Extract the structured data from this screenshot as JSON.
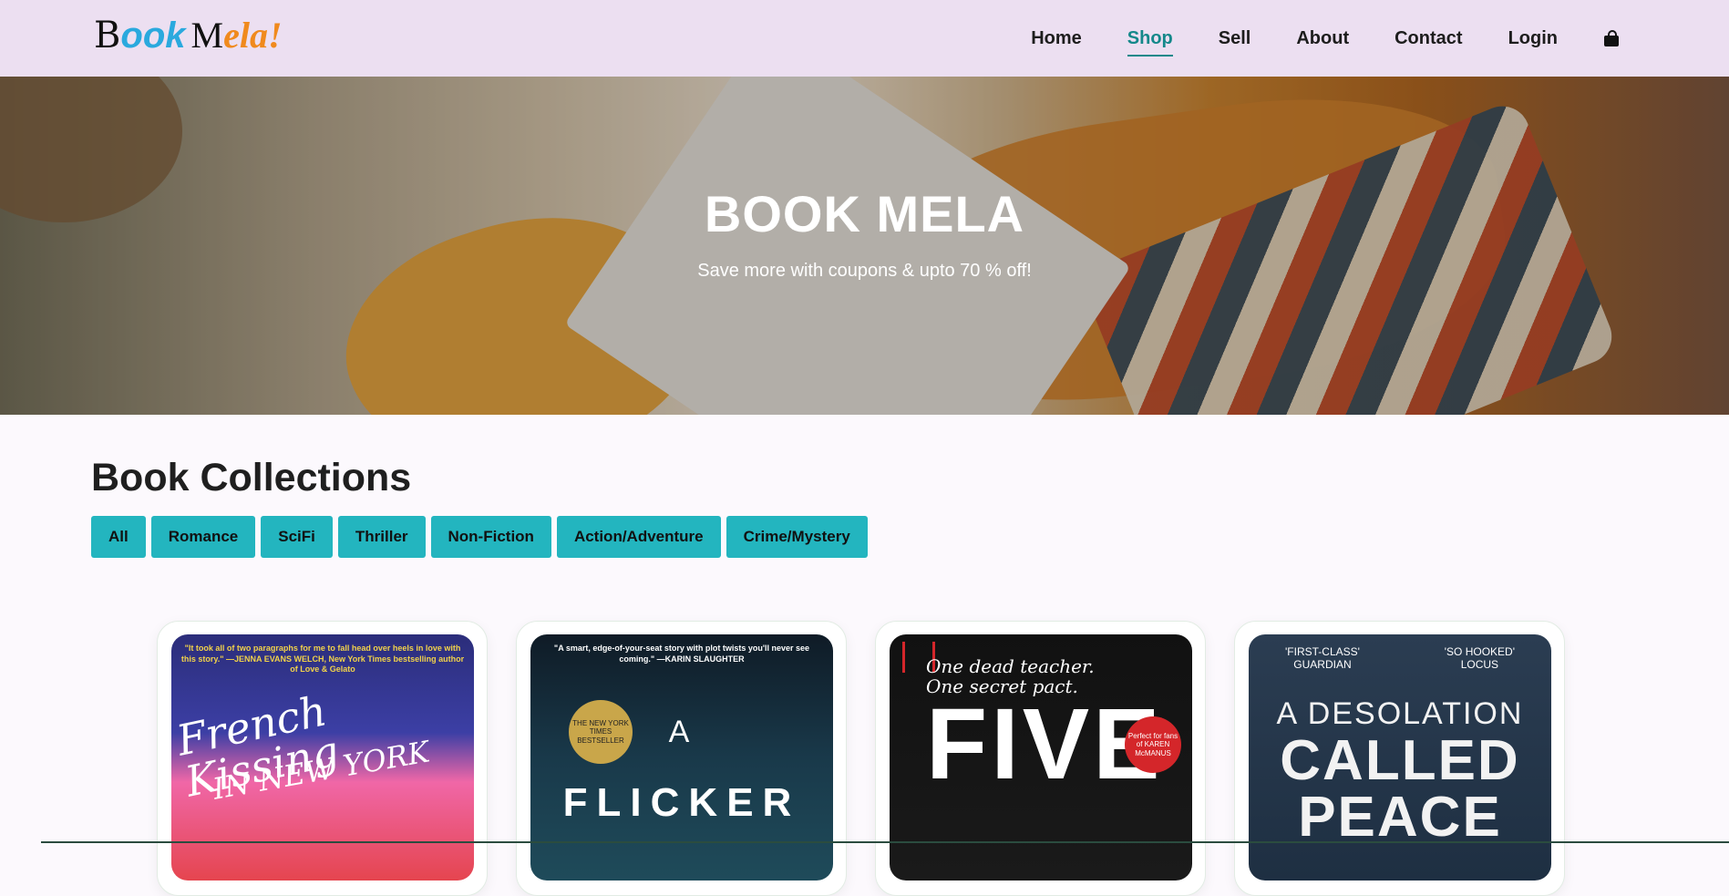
{
  "header": {
    "logo": {
      "b": "B",
      "ook": "ook",
      "m": "M",
      "ela": "ela!"
    },
    "nav": [
      {
        "label": "Home",
        "active": false
      },
      {
        "label": "Shop",
        "active": true
      },
      {
        "label": "Sell",
        "active": false
      },
      {
        "label": "About",
        "active": false
      },
      {
        "label": "Contact",
        "active": false
      },
      {
        "label": "Login",
        "active": false
      }
    ],
    "cart_icon": "shopping-bag-icon"
  },
  "hero": {
    "title": "BOOK MELA",
    "subtitle": "Save more with coupons & upto 70 % off!"
  },
  "collections": {
    "title": "Book Collections",
    "filters": [
      "All",
      "Romance",
      "SciFi",
      "Thriller",
      "Non-Fiction",
      "Action/Adventure",
      "Crime/Mystery"
    ]
  },
  "books": [
    {
      "quote": "\"It took all of two paragraphs for me to fall head over heels in love with this story.\" —JENNA EVANS WELCH, New York Times bestselling author of Love & Gelato",
      "title_line1": "French Kissing",
      "title_line2": "IN NEW YORK"
    },
    {
      "quote": "\"A smart, edge-of-your-seat story with plot twists you'll never see coming.\" —KARIN SLAUGHTER",
      "seal": "THE NEW YORK TIMES BESTSELLER",
      "title_line1": "A",
      "title_line2": "FLICKER"
    },
    {
      "tagline_line1": "One dead teacher.",
      "tagline_line2": "One secret pact.",
      "title_line1": "FIVE",
      "badge": "Perfect for fans of KAREN McMANUS"
    },
    {
      "press_left_1": "'FIRST-CLASS'",
      "press_left_2": "GUARDIAN",
      "press_right_1": "'SO HOOKED'",
      "press_right_2": "LOCUS",
      "title_line1": "A DESOLATION",
      "title_line2": "CALLED",
      "title_line3": "PEACE"
    }
  ],
  "colors": {
    "header_bg": "#ecdff1",
    "accent": "#14888a",
    "filter_bg": "#23b5bf"
  }
}
